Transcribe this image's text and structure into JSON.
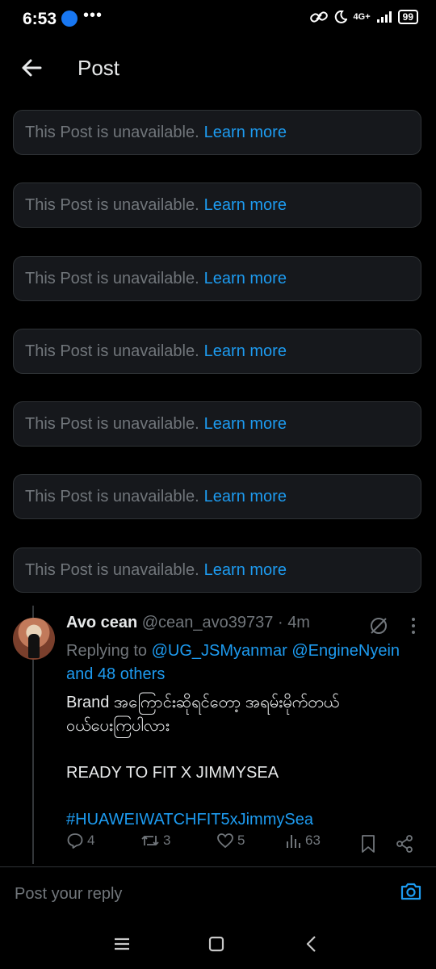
{
  "status_bar": {
    "time": "6:53",
    "more": "•••",
    "network": "4G+",
    "battery": "99"
  },
  "header": {
    "title": "Post"
  },
  "notices": [
    {
      "message": "This Post is unavailable.",
      "link": "Learn more"
    },
    {
      "message": "This Post is unavailable.",
      "link": "Learn more"
    },
    {
      "message": "This Post is unavailable.",
      "link": "Learn more"
    },
    {
      "message": "This Post is unavailable.",
      "link": "Learn more"
    },
    {
      "message": "This Post is unavailable.",
      "link": "Learn more"
    },
    {
      "message": "This Post is unavailable.",
      "link": "Learn more"
    },
    {
      "message": "This Post is unavailable.",
      "link": "Learn more"
    }
  ],
  "reply": {
    "author_name": "Avo cean",
    "author_handle": "@cean_avo39737",
    "separator": " · ",
    "time": "4m",
    "replying_label": "Replying to ",
    "mention1": "@UG_JSMyanmar",
    "mention2": "@EngineNyein",
    "and_others": "and 48 others",
    "text_line1": "Brand အကြောင်းဆိုရင်တော့ အရမ်းမိုက်တယ်",
    "text_line2": "ဝယ်ပေးကြပါလား",
    "text_line3": "READY TO FIT X JIMMYSEA",
    "hashtag": "#HUAWEIWATCHFIT5xJimmySea",
    "counts": {
      "replies": "4",
      "reposts": "3",
      "likes": "5",
      "views": "63"
    }
  },
  "compose": {
    "placeholder": "Post your reply"
  },
  "colors": {
    "accent": "#1d9bf0",
    "muted": "#71767b",
    "card_bg": "#16181c",
    "border": "#2f3336"
  }
}
